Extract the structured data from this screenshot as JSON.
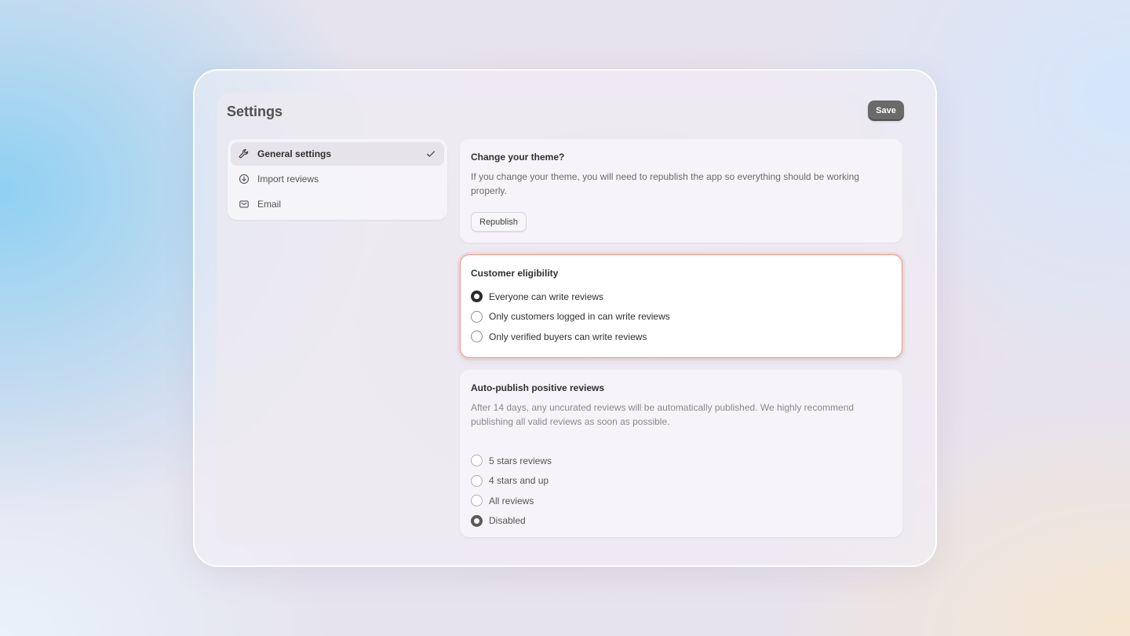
{
  "header": {
    "title": "Settings",
    "save_label": "Save"
  },
  "sidebar": {
    "items": [
      {
        "label": "General settings",
        "icon": "wrench-icon",
        "active": true
      },
      {
        "label": "Import reviews",
        "icon": "download-circle-icon",
        "active": false
      },
      {
        "label": "Email",
        "icon": "mail-icon",
        "active": false
      }
    ]
  },
  "theme_card": {
    "title": "Change your theme?",
    "description": "If you change your theme, you will need to republish the app so everything should be working properly.",
    "button_label": "Republish"
  },
  "eligibility_card": {
    "title": "Customer eligibility",
    "options": [
      {
        "label": "Everyone can write reviews",
        "selected": true
      },
      {
        "label": "Only customers logged in can write reviews",
        "selected": false
      },
      {
        "label": "Only verified buyers can write reviews",
        "selected": false
      }
    ]
  },
  "autopublish_card": {
    "title": "Auto-publish positive reviews",
    "description": "After 14 days, any uncurated reviews will be automatically published. We highly recommend publishing all valid reviews as soon as possible.",
    "options": [
      {
        "label": "5 stars reviews",
        "selected": false
      },
      {
        "label": "4 stars and up",
        "selected": false
      },
      {
        "label": "All reviews",
        "selected": false
      },
      {
        "label": "Disabled",
        "selected": true
      }
    ]
  },
  "colors": {
    "accent_border": "#e8998e",
    "save_button": "#6a6a6a"
  }
}
